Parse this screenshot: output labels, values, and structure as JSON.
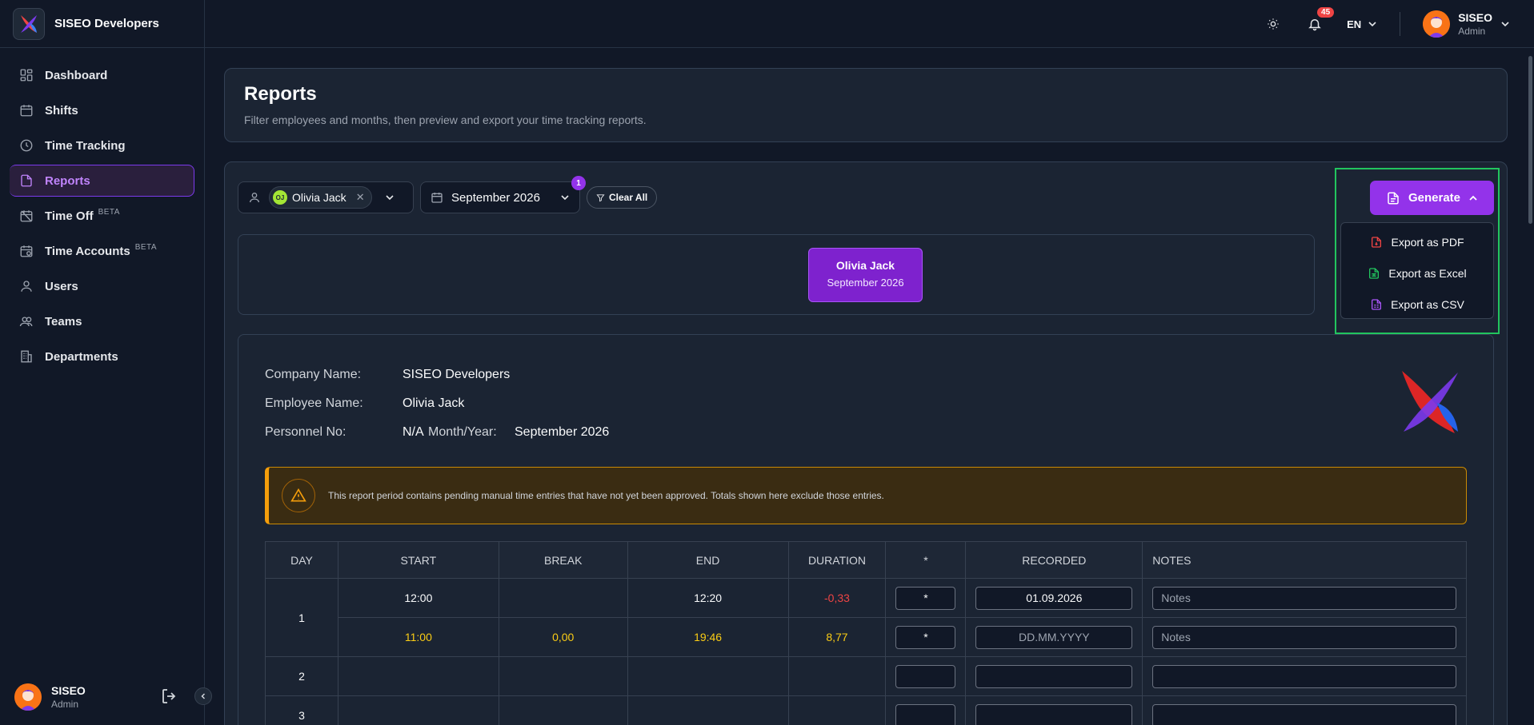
{
  "app": {
    "brand_name": "SISEO Developers"
  },
  "sidebar": {
    "items": [
      {
        "label": "Dashboard",
        "icon": "dashboard-icon"
      },
      {
        "label": "Shifts",
        "icon": "calendar-icon"
      },
      {
        "label": "Time Tracking",
        "icon": "clock-icon"
      },
      {
        "label": "Reports",
        "icon": "report-icon",
        "active": true
      },
      {
        "label": "Time Off",
        "icon": "calendar-off-icon",
        "badge": "BETA"
      },
      {
        "label": "Time Accounts",
        "icon": "calendar-clock-icon",
        "badge": "BETA"
      },
      {
        "label": "Users",
        "icon": "user-icon"
      },
      {
        "label": "Teams",
        "icon": "users-icon"
      },
      {
        "label": "Departments",
        "icon": "building-icon"
      }
    ],
    "user": {
      "name": "SISEO",
      "role": "Admin"
    }
  },
  "topbar": {
    "notifications_count": "45",
    "language": "EN",
    "user": {
      "name": "SISEO",
      "role": "Admin"
    }
  },
  "header": {
    "title": "Reports",
    "subtitle": "Filter employees and months, then preview and export your time tracking reports."
  },
  "filters": {
    "employee_chip": {
      "initials": "OJ",
      "name": "Olivia Jack"
    },
    "month": "September 2026",
    "month_count": "1",
    "clear_label": "Clear All"
  },
  "generate": {
    "label": "Generate",
    "menu": [
      {
        "label": "Export as PDF",
        "icon": "pdf-file-icon",
        "color": "#ef4444"
      },
      {
        "label": "Export as Excel",
        "icon": "excel-file-icon",
        "color": "#22c55e"
      },
      {
        "label": "Export as CSV",
        "icon": "csv-file-icon",
        "color": "#a855f7"
      }
    ]
  },
  "preview": {
    "name": "Olivia Jack",
    "month": "September 2026"
  },
  "report": {
    "company_label": "Company Name:",
    "company_value": "SISEO Developers",
    "employee_label": "Employee Name:",
    "employee_value": "Olivia Jack",
    "personnel_label": "Personnel No:",
    "personnel_value": "N/A",
    "month_label": "Month/Year:",
    "month_value": "September 2026",
    "warning": "This report period contains pending manual time entries that have not yet been approved. Totals shown here exclude those entries.",
    "columns": [
      "DAY",
      "START",
      "BREAK",
      "END",
      "DURATION",
      "*",
      "RECORDED",
      "NOTES"
    ],
    "rows": [
      {
        "day": "1",
        "start": "12:00",
        "break": "",
        "end": "12:20",
        "duration": "-0,33",
        "star": "*",
        "recorded": "01.09.2026",
        "notes_placeholder": "Notes"
      },
      {
        "day": "",
        "start": "11:00",
        "break": "0,00",
        "end": "19:46",
        "duration": "8,77",
        "star": "*",
        "recorded_placeholder": "DD.MM.YYYY",
        "notes_placeholder": "Notes"
      },
      {
        "day": "2"
      },
      {
        "day": "3"
      }
    ]
  },
  "colors": {
    "accent": "#9333ea",
    "highlight_frame": "#22c55e",
    "warning": "#f59e0b"
  }
}
